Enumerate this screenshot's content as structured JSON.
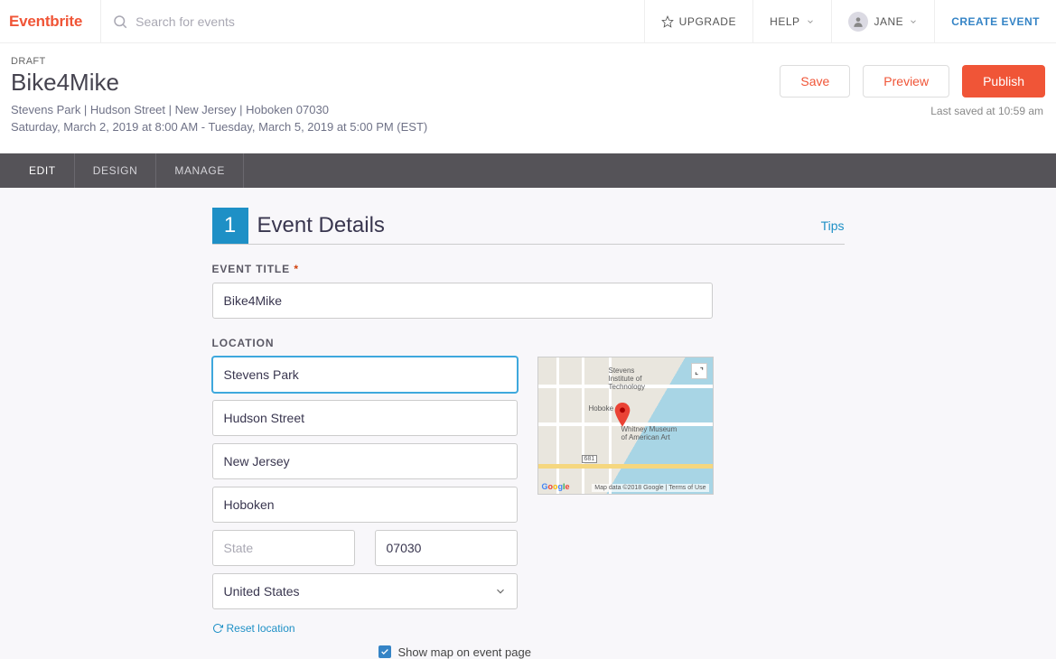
{
  "nav": {
    "logo": "Eventbrite",
    "search_placeholder": "Search for events",
    "upgrade": "UPGRADE",
    "help": "HELP",
    "user_name": "JANE",
    "create_event": "CREATE EVENT"
  },
  "header": {
    "status": "DRAFT",
    "title": "Bike4Mike",
    "location_line": "Stevens Park | Hudson Street | New Jersey | Hoboken 07030",
    "date_line": "Saturday, March 2, 2019 at 8:00 AM - Tuesday, March 5, 2019 at 5:00 PM (EST)",
    "save": "Save",
    "preview": "Preview",
    "publish": "Publish",
    "last_saved": "Last saved at 10:59 am"
  },
  "tabs": {
    "edit": "EDIT",
    "design": "DESIGN",
    "manage": "MANAGE"
  },
  "section": {
    "number": "1",
    "title": "Event Details",
    "tips": "Tips"
  },
  "form": {
    "title_label": "EVENT TITLE",
    "title_value": "Bike4Mike",
    "location_label": "LOCATION",
    "venue": "Stevens Park",
    "address": "Hudson Street",
    "address2": "New Jersey",
    "city": "Hoboken",
    "state_placeholder": "State",
    "postal": "07030",
    "country": "United States",
    "reset": "Reset location",
    "show_map": "Show map on event page",
    "show_map_checked": true
  },
  "map": {
    "poi1": "Stevens\nInstitute of\nTechnology",
    "poi2": "Hoboke",
    "poi3": "Whitney Museum\nof American Art",
    "route": "681",
    "attribution": "Map data ©2018 Google | Terms of Use"
  }
}
